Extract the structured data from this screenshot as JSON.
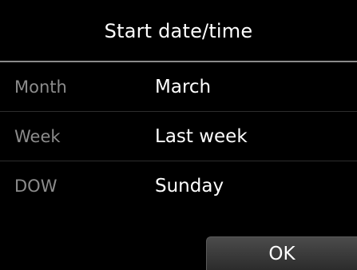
{
  "header": {
    "title": "Start date/time"
  },
  "settings": [
    {
      "label": "Month",
      "value": "March"
    },
    {
      "label": "Week",
      "value": "Last week"
    },
    {
      "label": "DOW",
      "value": "Sunday"
    }
  ],
  "actions": {
    "ok_label": "OK"
  },
  "colors": {
    "background": "#000000",
    "label_text": "#8c8c8c",
    "value_text": "#ffffff",
    "button_background": "#3a3a3a"
  }
}
